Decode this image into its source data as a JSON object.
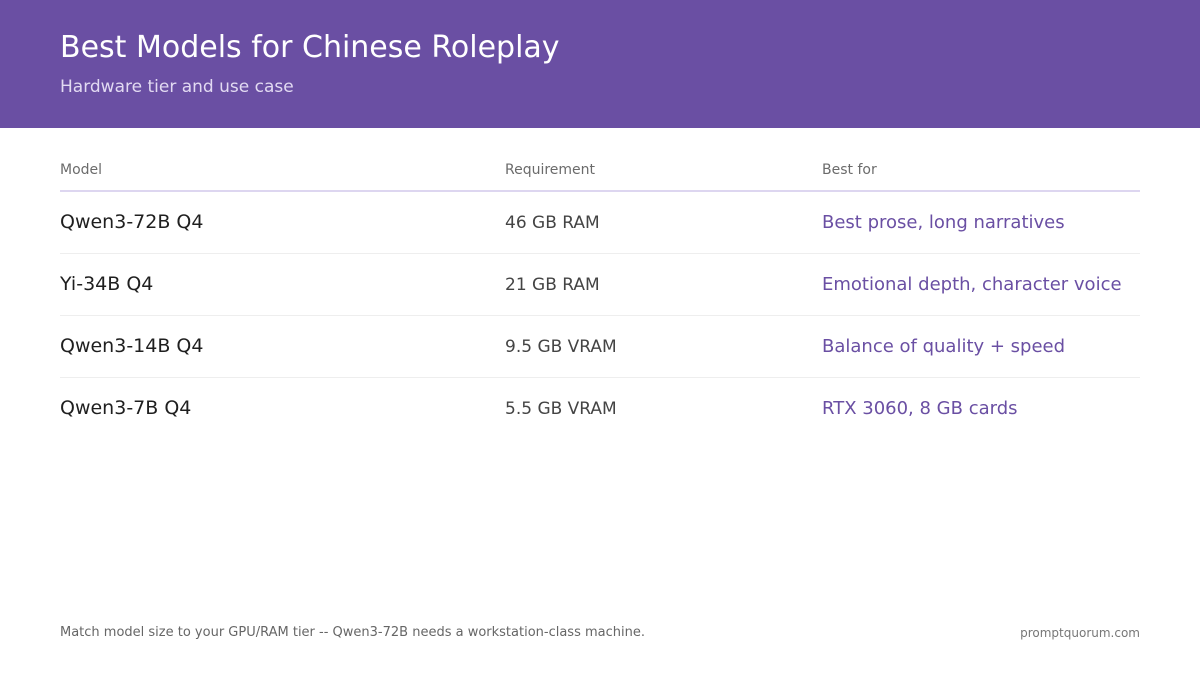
{
  "header": {
    "title": "Best Models for Chinese Roleplay",
    "subtitle": "Hardware tier and use case"
  },
  "table": {
    "columns": [
      "Model",
      "Requirement",
      "Best for"
    ],
    "rows": [
      {
        "model": "Qwen3-72B Q4",
        "requirement": "46 GB RAM",
        "best_for": "Best prose, long narratives"
      },
      {
        "model": "Yi-34B Q4",
        "requirement": "21 GB RAM",
        "best_for": "Emotional depth, character voice"
      },
      {
        "model": "Qwen3-14B Q4",
        "requirement": "9.5 GB VRAM",
        "best_for": "Balance of quality + speed"
      },
      {
        "model": "Qwen3-7B Q4",
        "requirement": "5.5 GB VRAM",
        "best_for": "RTX 3060, 8 GB cards"
      }
    ]
  },
  "footer": {
    "note": "Match model size to your GPU/RAM tier -- Qwen3-72B needs a workstation-class machine.",
    "brand": "promptquorum.com"
  },
  "colors": {
    "header_bg": "#6a4fa3",
    "accent": "#6a4fa3"
  }
}
